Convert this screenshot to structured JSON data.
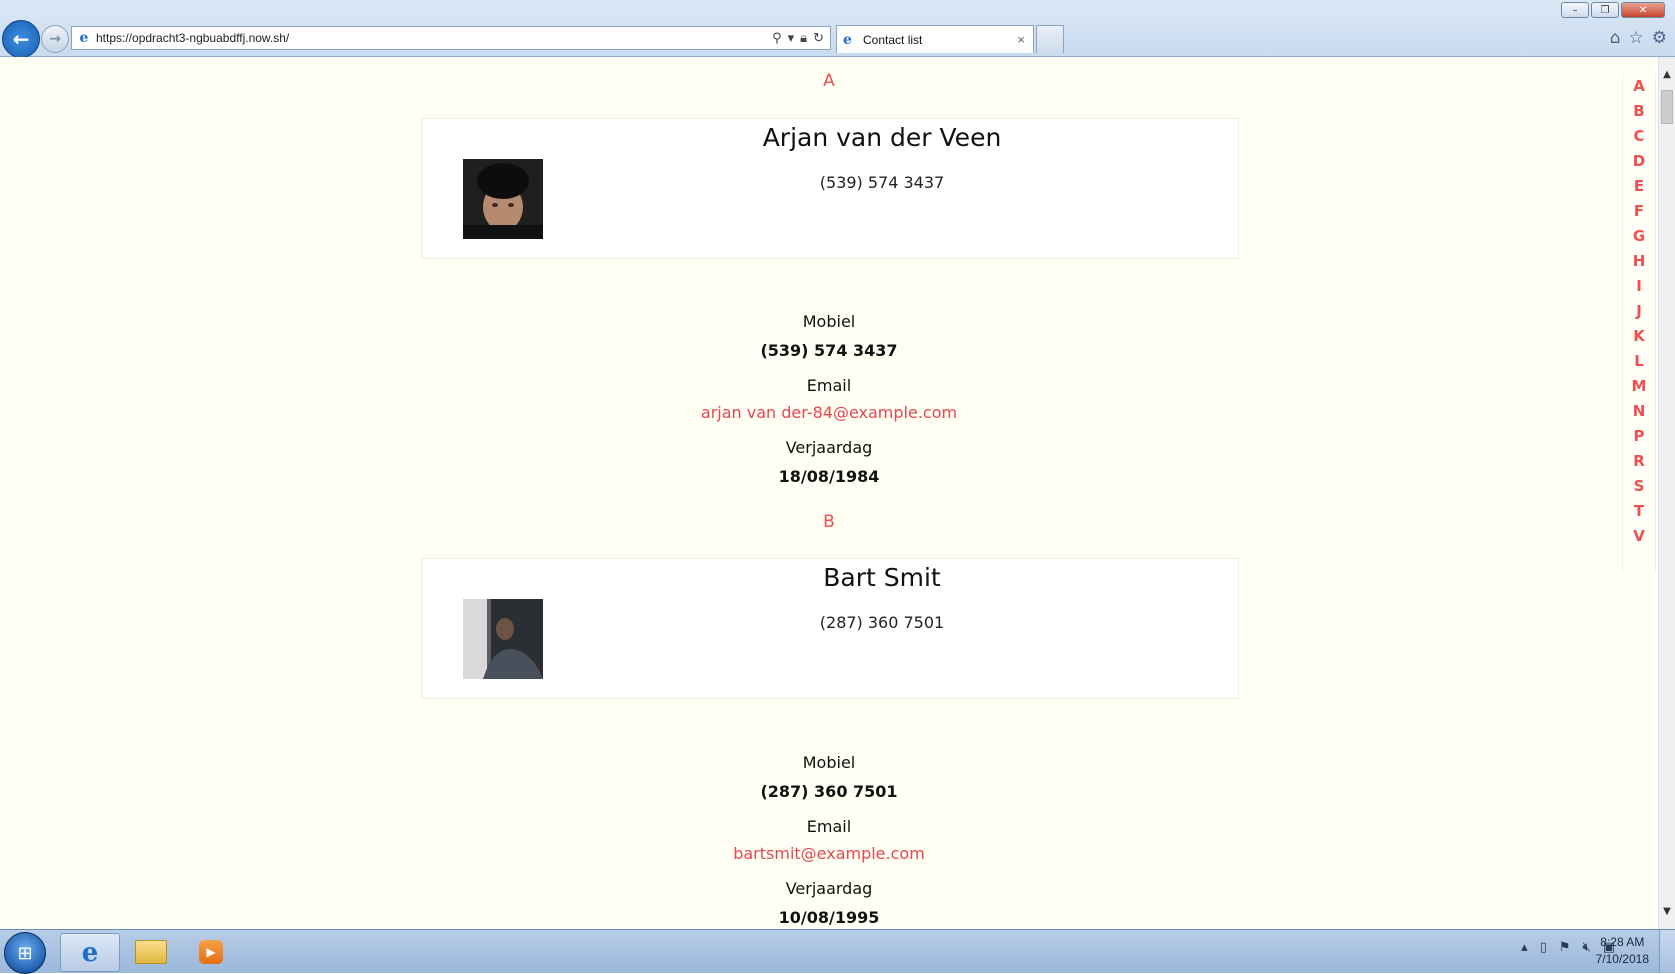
{
  "browser": {
    "url_prefix": "https://",
    "url_rest": "opdracht3-ngbuabdffj.now.sh/",
    "tab_title": "Contact list",
    "tab_close": "×"
  },
  "contacts": [
    {
      "letter": "A",
      "name": "Arjan van der Veen",
      "phone": "(539) 574 3437",
      "mobile_label": "Mobiel",
      "mobile": "(539) 574 3437",
      "email_label": "Email",
      "email": "arjan van der-84@example.com",
      "birthday_label": "Verjaardag",
      "birthday": "18/08/1984"
    },
    {
      "letter": "B",
      "name": "Bart Smit",
      "phone": "(287) 360 7501",
      "mobile_label": "Mobiel",
      "mobile": "(287) 360 7501",
      "email_label": "Email",
      "email": "bartsmit@example.com",
      "birthday_label": "Verjaardag",
      "birthday": "10/08/1995"
    }
  ],
  "alphabet": [
    "A",
    "B",
    "C",
    "D",
    "E",
    "F",
    "G",
    "H",
    "I",
    "J",
    "K",
    "L",
    "M",
    "N",
    "P",
    "R",
    "S",
    "T",
    "V"
  ],
  "taskbar": {
    "time": "8:28 AM",
    "date": "7/10/2018"
  }
}
